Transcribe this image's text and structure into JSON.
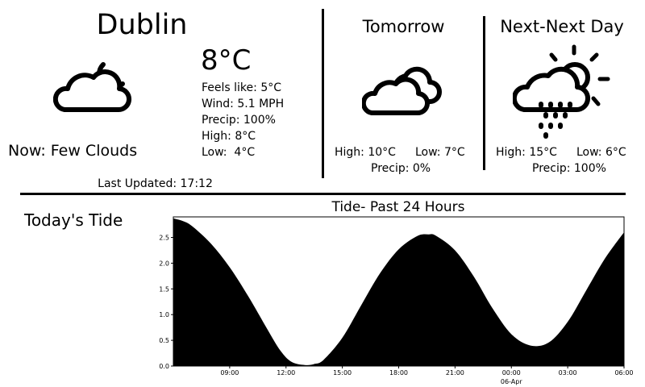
{
  "current": {
    "city": "Dublin",
    "temperature": "8°C",
    "feels_like": "Feels like: 5°C",
    "wind": "Wind: 5.1 MPH",
    "precip": "Precip: 100%",
    "high": "High: 8°C",
    "low": "Low:  4°C",
    "condition": "Now: Few Clouds",
    "last_updated": "Last Updated: 17:12",
    "icon": "few-clouds-night-icon"
  },
  "tomorrow": {
    "title": "Tomorrow",
    "high": "High: 10°C",
    "low": "Low: 7°C",
    "precip": "Precip: 0%",
    "icon": "clouds-icon"
  },
  "next_next": {
    "title": "Next-Next Day",
    "high": "High: 15°C",
    "low": "Low: 6°C",
    "precip": "Precip: 100%",
    "icon": "rain-sun-cloud-icon"
  },
  "tide": {
    "section_title": "Today's Tide"
  },
  "chart_data": {
    "type": "area",
    "title": "Tide- Past 24 Hours",
    "x_hours": [
      6.0,
      6.5,
      7.0,
      8.0,
      9.0,
      10.0,
      11.0,
      11.7,
      12.3,
      13.0,
      13.5,
      14.0,
      15.0,
      16.0,
      17.0,
      18.0,
      19.0,
      19.6,
      20.0,
      21.0,
      22.0,
      23.0,
      24.0,
      25.0,
      26.0,
      27.0,
      28.0,
      29.0,
      30.0
    ],
    "values": [
      2.87,
      2.82,
      2.72,
      2.38,
      1.92,
      1.35,
      0.72,
      0.3,
      0.08,
      0.02,
      0.04,
      0.12,
      0.55,
      1.18,
      1.8,
      2.27,
      2.53,
      2.56,
      2.53,
      2.25,
      1.74,
      1.12,
      0.62,
      0.4,
      0.46,
      0.86,
      1.48,
      2.1,
      2.6
    ],
    "ylim": [
      0.0,
      2.9
    ],
    "xlim": [
      6.0,
      30.0
    ],
    "y_ticks": [
      0.0,
      0.5,
      1.0,
      1.5,
      2.0,
      2.5
    ],
    "y_tick_labels": [
      "0.0",
      "0.5",
      "1.0",
      "1.5",
      "2.0",
      "2.5"
    ],
    "x_ticks": [
      9,
      12,
      15,
      18,
      21,
      24,
      27,
      30
    ],
    "x_tick_labels": [
      "09:00",
      "12:00",
      "15:00",
      "18:00",
      "21:00",
      "00:00",
      "03:00",
      "06:00"
    ],
    "x_sub_label": "06-Apr",
    "fill_color": "#000000"
  }
}
